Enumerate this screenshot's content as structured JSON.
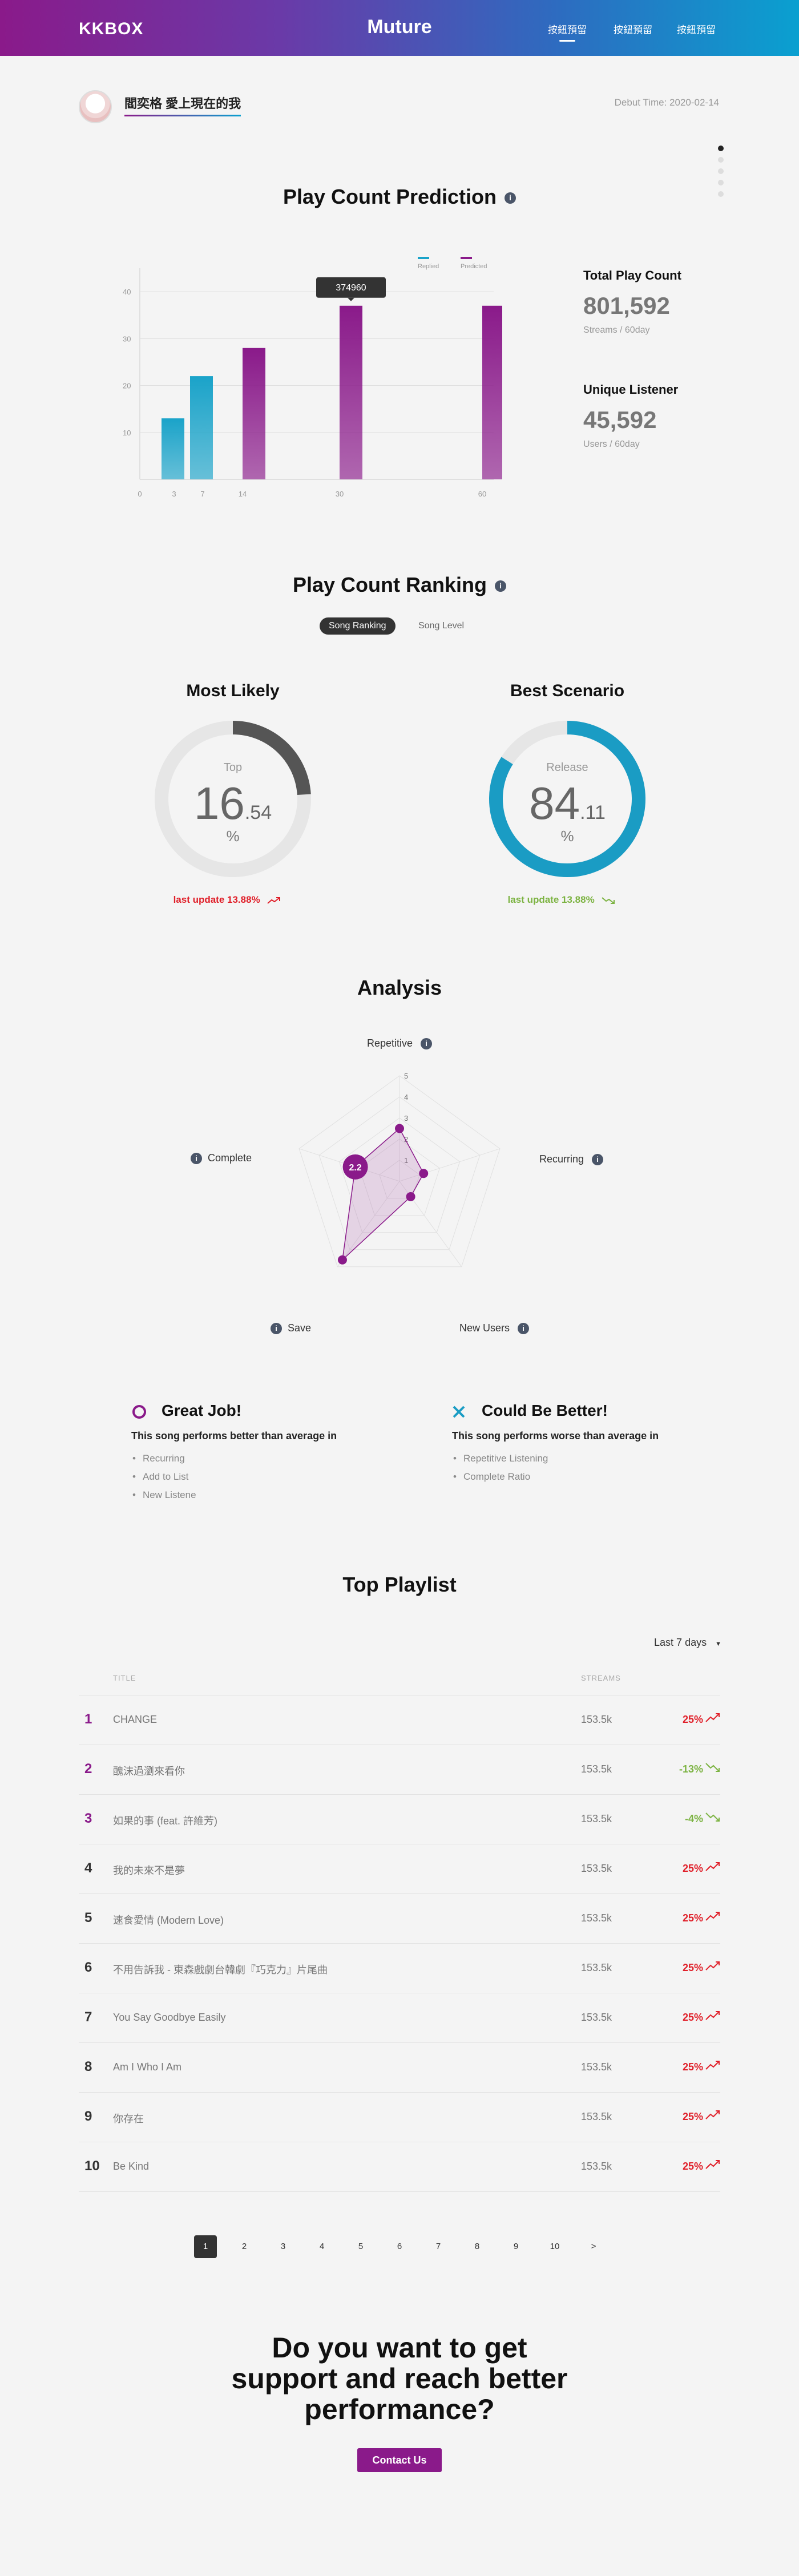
{
  "header": {
    "logo": "KKBOX",
    "brand": "Muture",
    "nav": [
      "按鈕預留",
      "按鈕預留",
      "按鈕預留"
    ]
  },
  "song": {
    "title": "閻奕格 愛上現在的我",
    "debut": "Debut Time: 2020-02-14"
  },
  "prediction": {
    "title": "Play Count Prediction",
    "info_icon": "i",
    "total_label": "Total Play Count",
    "total_value": "801,592",
    "total_sub": "Streams  / 60day",
    "unique_label": "Unique Listener",
    "unique_value": "45,592",
    "unique_sub": "Users  / 60day",
    "tooltip": "374960"
  },
  "chart_data": {
    "type": "bar",
    "title": "",
    "xlabel": "",
    "ylabel": "",
    "x_ticks": [
      "0",
      "3",
      "7",
      "14",
      "30",
      "60"
    ],
    "y_ticks": [
      "10",
      "20",
      "30",
      "40"
    ],
    "ylim": [
      0,
      45
    ],
    "series": [
      {
        "name": "Replied",
        "color": "#1aa3c9",
        "points": [
          {
            "x": "3",
            "y": 13
          },
          {
            "x": "7",
            "y": 22
          }
        ]
      },
      {
        "name": "Predicted",
        "color": "#8a1a8a",
        "points": [
          {
            "x": "14",
            "y": 28
          },
          {
            "x": "30",
            "y": 37
          },
          {
            "x": "60",
            "y": 37
          }
        ]
      }
    ],
    "legend": "top-right",
    "grid": true
  },
  "ranking": {
    "title": "Play Count Ranking",
    "tabs": [
      "Song Ranking",
      "Song Level"
    ],
    "most_likely": {
      "title": "Most Likely",
      "label": "Top",
      "int": "16",
      "dec": ".54",
      "unit": "%",
      "update": "last update 13.88%",
      "fill": 0.24,
      "color": "#555555",
      "update_color": "#e0202a"
    },
    "best_scenario": {
      "title": "Best Scenario",
      "label": "Release",
      "int": "84",
      "dec": ".11",
      "unit": "%",
      "update": "last update 13.88%",
      "fill": 0.84,
      "color": "#1a9cc4",
      "update_color": "#7cb342"
    }
  },
  "analysis": {
    "title": "Analysis",
    "axes": [
      "Repetitive",
      "Recurring",
      "New Users",
      "Save",
      "Complete"
    ],
    "scale_labels": [
      "1",
      "2",
      "3",
      "4",
      "5"
    ],
    "values": [
      2.5,
      1.2,
      0.9,
      4.6,
      2.2
    ],
    "highlight": "2.2"
  },
  "feedback": {
    "good_title": "Great Job!",
    "good_sub": "This song performs better than average in",
    "good_items": [
      "Recurring",
      "Add to List",
      "New Listene"
    ],
    "bad_title": "Could Be Better!",
    "bad_sub": "This song performs worse than average in",
    "bad_items": [
      "Repetitive Listening",
      "Complete Ratio"
    ]
  },
  "playlist": {
    "title": "Top Playlist",
    "period": "Last 7 days",
    "col_title": "TITLE",
    "col_streams": "STREAMS",
    "rows": [
      {
        "rank": "1",
        "title": "CHANGE",
        "streams": "153.5k",
        "pct": "25%",
        "up": true
      },
      {
        "rank": "2",
        "title": "醜沫過瀏來看你",
        "streams": "153.5k",
        "pct": "-13%",
        "up": false
      },
      {
        "rank": "3",
        "title": "如果的事 (feat. 許維芳)",
        "streams": "153.5k",
        "pct": "-4%",
        "up": false
      },
      {
        "rank": "4",
        "title": "我的未來不是夢",
        "streams": "153.5k",
        "pct": "25%",
        "up": true
      },
      {
        "rank": "5",
        "title": "速食愛情 (Modern Love)",
        "streams": "153.5k",
        "pct": "25%",
        "up": true
      },
      {
        "rank": "6",
        "title": "不用告訴我 - 東森戲劇台韓劇『巧克力』片尾曲",
        "streams": "153.5k",
        "pct": "25%",
        "up": true
      },
      {
        "rank": "7",
        "title": "You Say Goodbye Easily",
        "streams": "153.5k",
        "pct": "25%",
        "up": true
      },
      {
        "rank": "8",
        "title": "Am I Who I Am",
        "streams": "153.5k",
        "pct": "25%",
        "up": true
      },
      {
        "rank": "9",
        "title": "你存在",
        "streams": "153.5k",
        "pct": "25%",
        "up": true
      },
      {
        "rank": "10",
        "title": "Be Kind",
        "streams": "153.5k",
        "pct": "25%",
        "up": true
      }
    ],
    "pages": [
      "1",
      "2",
      "3",
      "4",
      "5",
      "6",
      "7",
      "8",
      "9",
      "10",
      ">"
    ]
  },
  "cta": {
    "line1": "Do you want to get",
    "line2": "support and reach better",
    "line3": "performance?",
    "button": "Contact Us"
  },
  "colors": {
    "purple": "#8a1a8a",
    "blue": "#1aa3c9",
    "up": "#e0202a",
    "down": "#7cb342"
  }
}
